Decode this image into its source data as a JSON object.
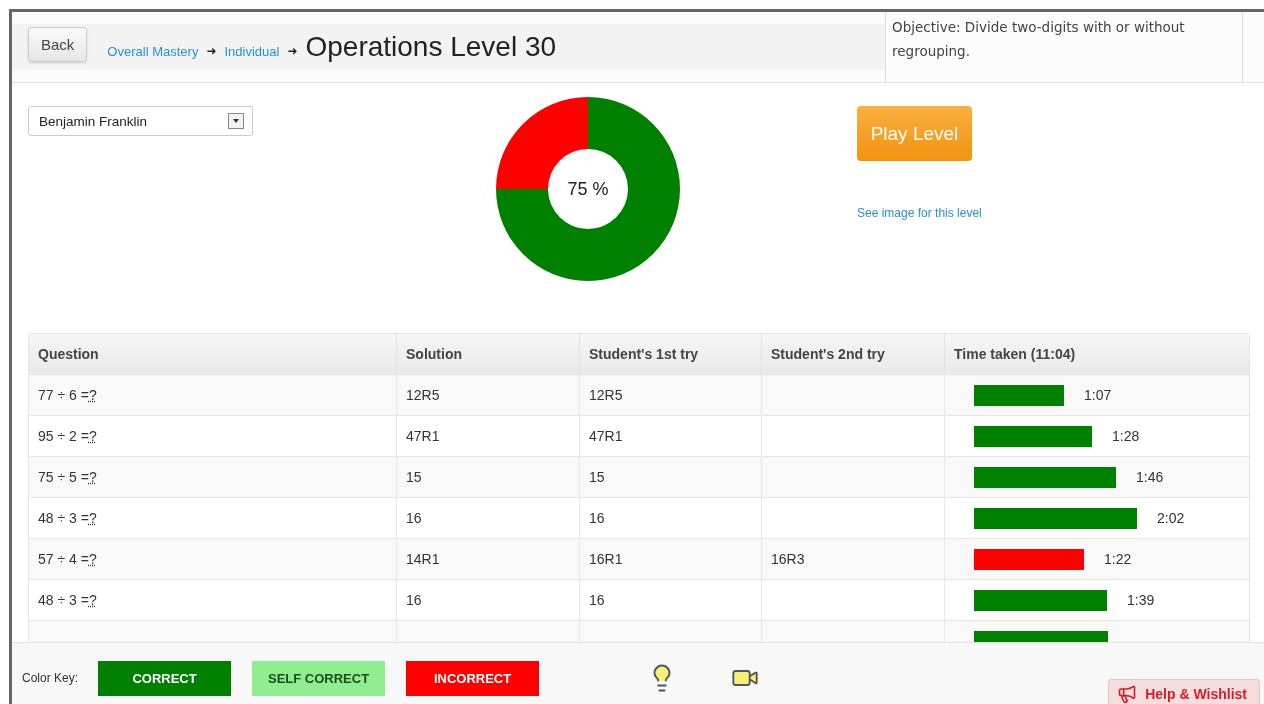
{
  "header": {
    "back_button": "Back",
    "breadcrumb": [
      {
        "label": "Overall Mastery"
      },
      {
        "label": "Individual"
      }
    ],
    "separator": "➜",
    "title": "Operations Level 30",
    "objective": "Objective: Divide two-digits with or without regrouping."
  },
  "student_select": {
    "value": "Benjamin Franklin"
  },
  "mastery": {
    "label": "75 %",
    "chart_data": {
      "type": "donut",
      "values": [
        75,
        25
      ]
    }
  },
  "play_button": "Play Level",
  "image_link": "See image for this level",
  "table": {
    "columns": [
      "Question",
      "Solution",
      "Student's 1st try",
      "Student's 2nd try",
      "Time taken (11:04)"
    ],
    "rows": [
      {
        "question": "77 ÷ 6 = ",
        "answer_mark": "?",
        "solution": "12R5",
        "try_1": "12R5",
        "time": "1:07",
        "color": "#008000"
      },
      {
        "question": "95 ÷ 2 = ",
        "answer_mark": "?",
        "solution": "47R1",
        "try_1": "47R1",
        "time": "1:28",
        "color": "#008000"
      },
      {
        "question": "75 ÷ 5 = ",
        "answer_mark": "?",
        "solution": "15",
        "try_1": "15",
        "time": "1:46",
        "color": "#008000"
      },
      {
        "question": "48 ÷ 3 = ",
        "answer_mark": "?",
        "solution": "16",
        "try_1": "16",
        "time": "2:02",
        "color": "#008000"
      },
      {
        "question": "57 ÷ 4 = ",
        "answer_mark": "?",
        "solution": "14R1",
        "try_1": "16R1",
        "try_2": "16R3",
        "time": "1:22",
        "color": "#ff0000"
      },
      {
        "question": "48 ÷ 3 = ",
        "answer_mark": "?",
        "solution": "16",
        "try_1": "16",
        "time": "1:39",
        "color": "#008000"
      },
      {
        "color": "#008000"
      }
    ]
  },
  "color_key": {
    "label": "Color Key:",
    "items": [
      {
        "label": "CORRECT",
        "color": "#008000"
      },
      {
        "label": "SELF CORRECT",
        "color": "#90ee90"
      },
      {
        "label": "INCORRECT",
        "color": "#ff0000"
      }
    ]
  },
  "help_button": "Help & Wishlist"
}
